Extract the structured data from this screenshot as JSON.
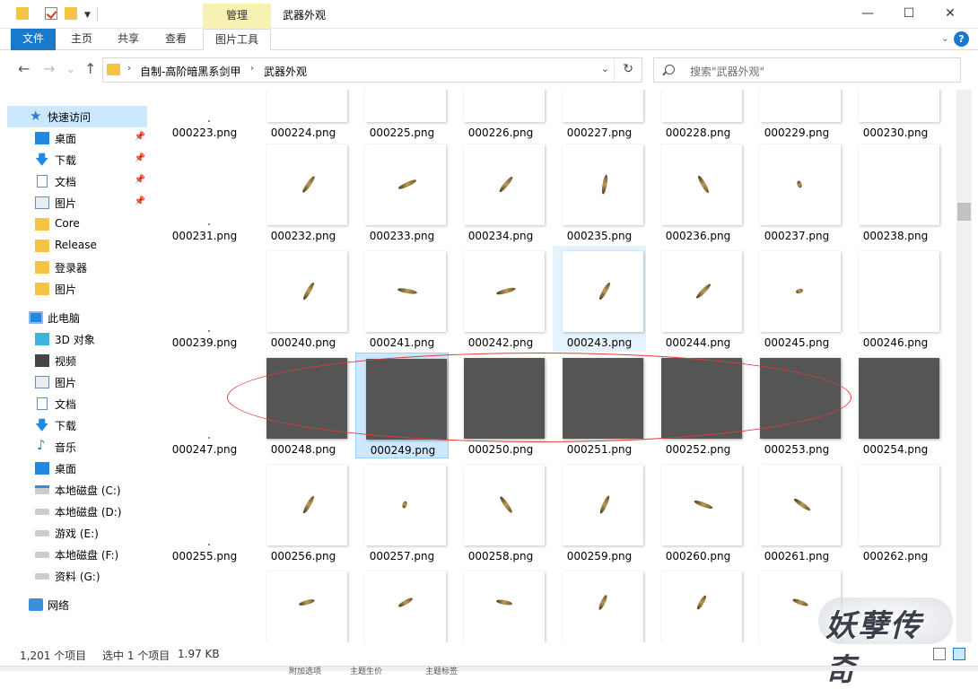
{
  "titlebar": {
    "context_tab": "管理",
    "title": "武器外观",
    "minimize": "—",
    "maximize": "☐",
    "close": "✕"
  },
  "ribbon": {
    "tabs": [
      "文件",
      "主页",
      "共享",
      "查看",
      "图片工具"
    ],
    "help": "?"
  },
  "nav": {
    "back": "←",
    "forward": "→",
    "up": "↑",
    "breadcrumb": [
      "自制-高阶暗黑系剑甲",
      "武器外观"
    ],
    "refresh": "↻",
    "dropdown": "⌄"
  },
  "search": {
    "placeholder": "搜索\"武器外观\""
  },
  "sidebar": {
    "quick_access": "快速访问",
    "items": [
      {
        "label": "桌面",
        "icon": "desktop-icon",
        "pinned": true
      },
      {
        "label": "下载",
        "icon": "download-icon",
        "pinned": true
      },
      {
        "label": "文档",
        "icon": "document-icon",
        "pinned": true
      },
      {
        "label": "图片",
        "icon": "pictures-icon",
        "pinned": true
      },
      {
        "label": "Core",
        "icon": "folder-icon",
        "pinned": false
      },
      {
        "label": "Release",
        "icon": "folder-icon",
        "pinned": false
      },
      {
        "label": "登录器",
        "icon": "folder-icon",
        "pinned": false
      },
      {
        "label": "图片",
        "icon": "folder-icon",
        "pinned": false
      }
    ],
    "this_pc": "此电脑",
    "pc_items": [
      {
        "label": "3D 对象",
        "icon": "3d-objects-icon"
      },
      {
        "label": "视频",
        "icon": "video-icon"
      },
      {
        "label": "图片",
        "icon": "pictures-icon"
      },
      {
        "label": "文档",
        "icon": "document-icon"
      },
      {
        "label": "下载",
        "icon": "download-icon"
      },
      {
        "label": "音乐",
        "icon": "music-icon"
      },
      {
        "label": "桌面",
        "icon": "desktop-icon"
      },
      {
        "label": "本地磁盘 (C:)",
        "icon": "drive-c-icon"
      },
      {
        "label": "本地磁盘 (D:)",
        "icon": "drive-icon"
      },
      {
        "label": "游戏 (E:)",
        "icon": "drive-icon"
      },
      {
        "label": "本地磁盘 (F:)",
        "icon": "drive-icon"
      },
      {
        "label": "资料 (G:)",
        "icon": "drive-icon"
      }
    ],
    "network": "网络"
  },
  "files": {
    "rows": [
      [
        "000223.png",
        "000224.png",
        "000225.png",
        "000226.png",
        "000227.png",
        "000228.png",
        "000229.png",
        "000230.png"
      ],
      [
        "000231.png",
        "000232.png",
        "000233.png",
        "000234.png",
        "000235.png",
        "000236.png",
        "000237.png",
        "000238.png"
      ],
      [
        "000239.png",
        "000240.png",
        "000241.png",
        "000242.png",
        "000243.png",
        "000244.png",
        "000245.png",
        "000246.png"
      ],
      [
        "000247.png",
        "000248.png",
        "000249.png",
        "000250.png",
        "000251.png",
        "000252.png",
        "000253.png",
        "000254.png"
      ],
      [
        "000255.png",
        "000256.png",
        "000257.png",
        "000258.png",
        "000259.png",
        "000260.png",
        "000261.png",
        "000262.png"
      ]
    ],
    "selected": "000249.png",
    "hovered": "000243.png"
  },
  "status": {
    "count": "1,201 个项目",
    "selection": "选中 1 个项目",
    "size": "1.97 KB"
  },
  "watermark": "妖孽传奇",
  "bottom_strip": [
    "附加选项",
    "主题生价",
    "主题标签"
  ]
}
